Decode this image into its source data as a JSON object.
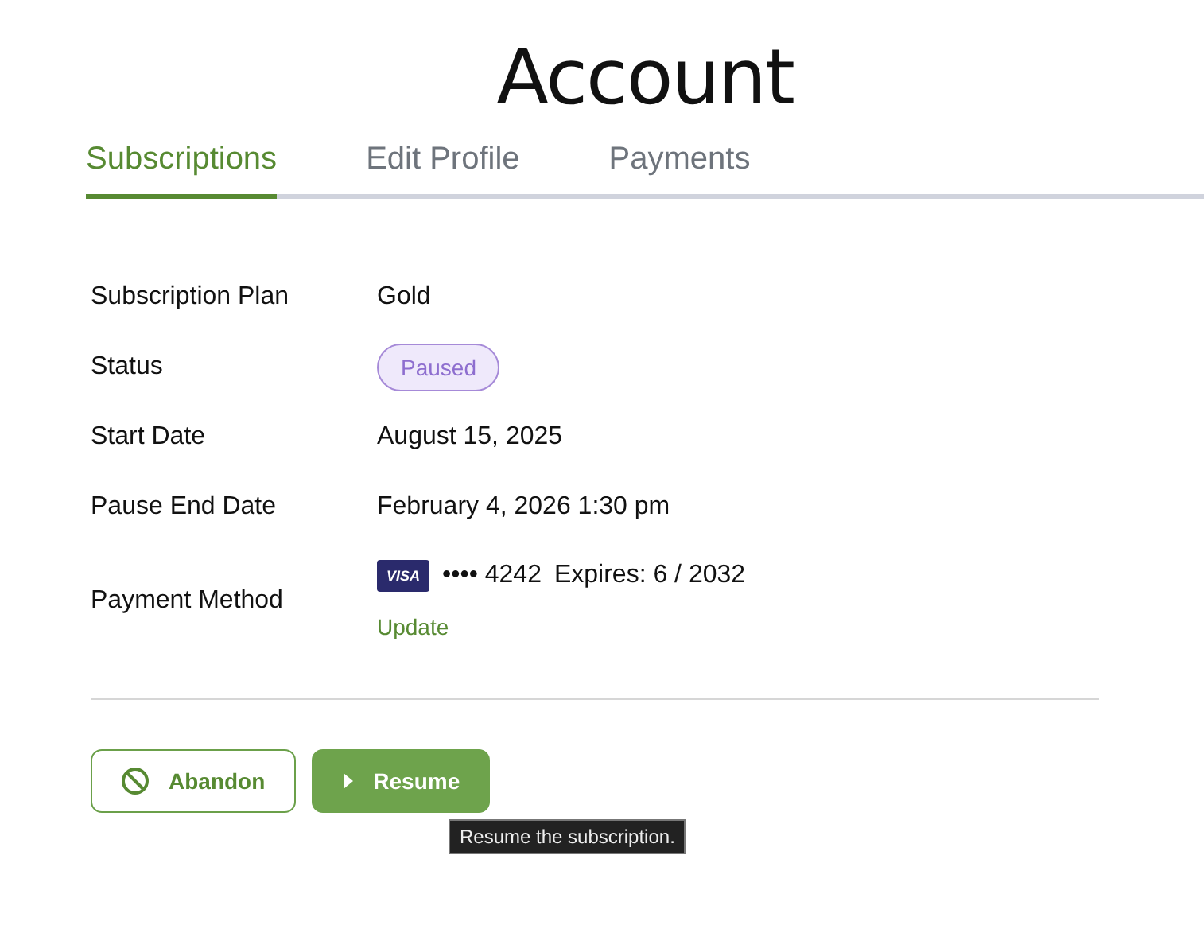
{
  "title": "Account",
  "tabs": [
    {
      "label": "Subscriptions",
      "selected": true
    },
    {
      "label": "Edit Profile",
      "selected": false
    },
    {
      "label": "Payments",
      "selected": false
    }
  ],
  "details": [
    {
      "kind": "text",
      "label": "Subscription Plan",
      "value": "Gold"
    },
    {
      "kind": "badge",
      "label": "Status",
      "value": "Paused"
    },
    {
      "kind": "text",
      "label": "Start Date",
      "value": "August 15, 2025"
    },
    {
      "kind": "text",
      "label": "Pause End Date",
      "value": "February 4, 2026 1:30 pm"
    },
    {
      "kind": "card",
      "label": "Payment Method",
      "brand": "VISA",
      "number": "•••• 4242",
      "expires": "Expires: 6 / 2032",
      "link": "Update"
    }
  ],
  "buttons": [
    {
      "kind": "outline",
      "label": "Abandon"
    },
    {
      "kind": "primary",
      "label": "Resume"
    }
  ],
  "tooltip": "Resume the subscription."
}
